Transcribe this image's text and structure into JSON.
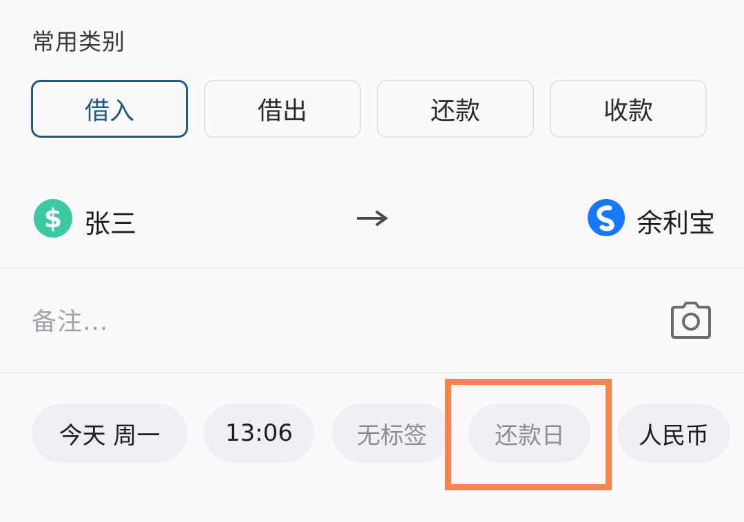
{
  "common_categories": {
    "title": "常用类别",
    "items": [
      {
        "label": "借入",
        "selected": true
      },
      {
        "label": "借出",
        "selected": false
      },
      {
        "label": "还款",
        "selected": false
      },
      {
        "label": "收款",
        "selected": false
      }
    ]
  },
  "transfer": {
    "from_account": {
      "name": "张三",
      "icon": "dollar-circle-icon",
      "icon_color": "#3cc8a0"
    },
    "arrow": "right-arrow-icon",
    "to_account": {
      "name": "余利宝",
      "icon": "yulibao-icon",
      "icon_color": "#1677ff"
    }
  },
  "note": {
    "placeholder": "备注...",
    "camera_icon": "camera-icon"
  },
  "chips": {
    "date": "今天 周一",
    "time": "13:06",
    "tag": "无标签",
    "repay_day": "还款日",
    "currency": "人民币"
  },
  "colors": {
    "accent": "#1f5a84",
    "highlight": "#f7864b"
  }
}
